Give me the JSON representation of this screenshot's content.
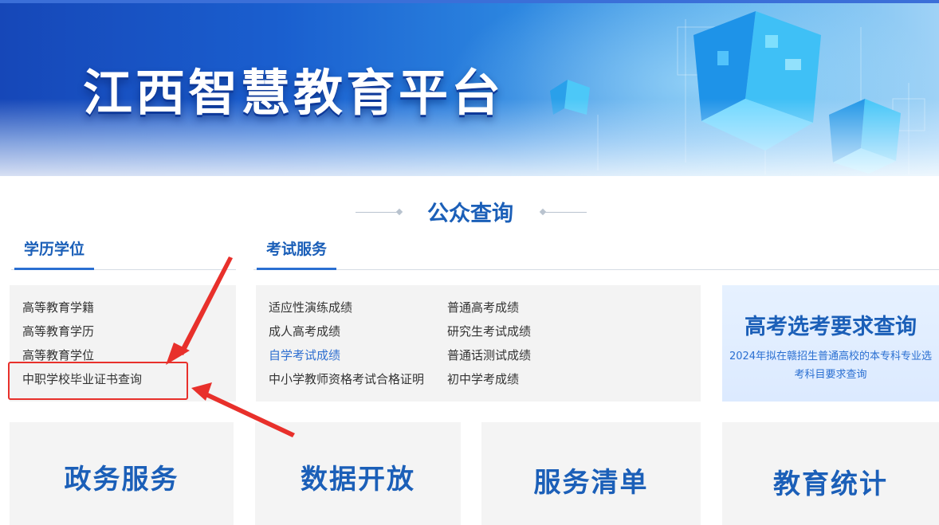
{
  "banner": {
    "title": "江西智慧教育平台"
  },
  "section": {
    "title": "公众查询"
  },
  "education": {
    "tab": "学历学位",
    "links": [
      "高等教育学籍",
      "高等教育学历",
      "高等教育学位",
      "中职学校毕业证书查询"
    ]
  },
  "exam": {
    "tab": "考试服务",
    "col1": [
      "适应性演练成绩",
      "成人高考成绩",
      "自学考试成绩",
      "中小学教师资格考试合格证明"
    ],
    "col2": [
      "普通高考成绩",
      "研究生考试成绩",
      "普通话测试成绩",
      "初中学考成绩"
    ]
  },
  "promo": {
    "title": "高考选考要求查询",
    "subtitle": "2024年拟在赣招生普通高校的本专科专业选考科目要求查询"
  },
  "tiles": [
    "政务服务",
    "数据开放",
    "服务清单",
    "教育统计"
  ],
  "colors": {
    "brand": "#1b5fb8",
    "accent": "#2a6fd1",
    "annotation": "#e8302b"
  }
}
